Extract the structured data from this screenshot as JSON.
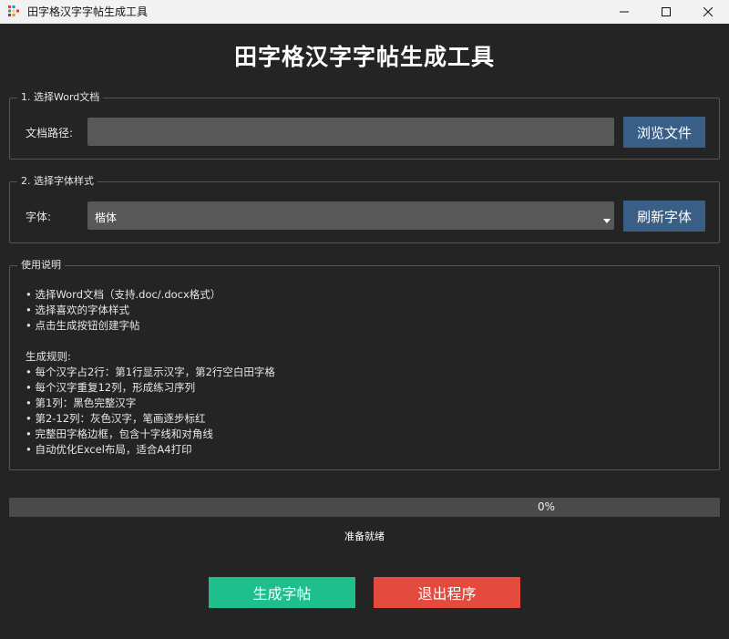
{
  "window": {
    "title": "田字格汉字字帖生成工具"
  },
  "header": {
    "title": "田字格汉字字帖生成工具"
  },
  "file_section": {
    "legend": "1. 选择Word文档",
    "path_label": "文档路径:",
    "path_value": "",
    "browse_label": "浏览文件"
  },
  "font_section": {
    "legend": "2. 选择字体样式",
    "font_label": "字体:",
    "selected_font": "楷体",
    "refresh_label": "刷新字体"
  },
  "instructions": {
    "legend": "使用说明",
    "lines": [
      "• 选择Word文档（支持.doc/.docx格式）",
      "• 选择喜欢的字体样式",
      "• 点击生成按钮创建字帖",
      "",
      "生成规则:",
      "• 每个汉字占2行：第1行显示汉字，第2行空白田字格",
      "• 每个汉字重复12列，形成练习序列",
      "• 第1列：黑色完整汉字",
      "• 第2-12列：灰色汉字，笔画逐步标红",
      "• 完整田字格边框，包含十字线和对角线",
      "• 自动优化Excel布局，适合A4打印"
    ]
  },
  "progress": {
    "value": 0,
    "label": "0%"
  },
  "status": {
    "text": "准备就绪"
  },
  "actions": {
    "generate_label": "生成字帖",
    "exit_label": "退出程序"
  },
  "colors": {
    "background": "#242424",
    "accent_blue": "#3a5f86",
    "generate_green": "#1fbe8d",
    "exit_red": "#e44b3e"
  }
}
